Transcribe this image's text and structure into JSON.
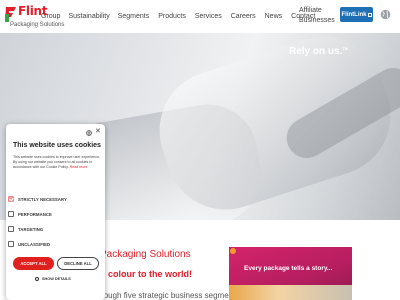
{
  "header": {
    "logo_word": "Flint",
    "logo_sub": "Packaging Solutions",
    "nav": [
      "Group",
      "Sustainability",
      "Segments",
      "Products",
      "Services",
      "Careers",
      "News",
      "Contact"
    ],
    "affiliate_line1": "Affiliate",
    "affiliate_line2": "Businesses",
    "flintlink_label": "FlintLink"
  },
  "hero": {
    "tagline": "Rely on us.",
    "tagline_mark": "TM"
  },
  "section": {
    "title": "Packaging Solutions",
    "subtitle": "g colour to the world!",
    "body": "Operating through five strategic business segments worldwide"
  },
  "story_card": {
    "text": "Every package tells a story..."
  },
  "cookie": {
    "title": "This website uses cookies",
    "text": "This website uses cookies to improve user experience. By using our website you consent to all cookies in accordance with our Cookie Policy.",
    "read_more": "Read more",
    "options": [
      {
        "label": "STRICTLY NECESSARY",
        "checked": true
      },
      {
        "label": "PERFORMANCE",
        "checked": false
      },
      {
        "label": "TARGETING",
        "checked": false
      },
      {
        "label": "UNCLASSIFIED",
        "checked": false
      }
    ],
    "accept_label": "ACCEPT ALL",
    "decline_label": "DECLINE ALL",
    "details_label": "SHOW DETAILS"
  },
  "colors": {
    "brand_red": "#e41e2b",
    "flintlink_blue": "#1f6fb6",
    "story_magenta": "#c4205f"
  }
}
